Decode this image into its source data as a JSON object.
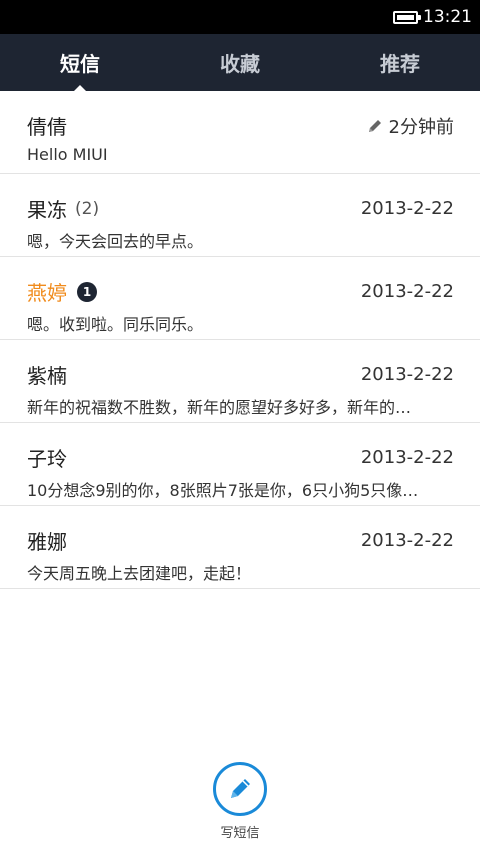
{
  "status_bar": {
    "time": "13:21",
    "battery_icon": "battery-icon"
  },
  "tabs": [
    {
      "label": "短信",
      "active": true
    },
    {
      "label": "收藏",
      "active": false
    },
    {
      "label": "推荐",
      "active": false
    }
  ],
  "threads": [
    {
      "name": "倩倩",
      "count": "",
      "unread": "",
      "date": "2分钟前",
      "draft": true,
      "snippet": "Hello MIUI",
      "highlight": false
    },
    {
      "name": "果冻",
      "count": "(2)",
      "unread": "",
      "date": "2013-2-22",
      "draft": false,
      "snippet": "嗯，今天会回去的早点。",
      "highlight": false
    },
    {
      "name": "燕婷",
      "count": "",
      "unread": "1",
      "date": "2013-2-22",
      "draft": false,
      "snippet": "嗯。收到啦。同乐同乐。",
      "highlight": true
    },
    {
      "name": "紫楠",
      "count": "",
      "unread": "",
      "date": "2013-2-22",
      "draft": false,
      "snippet": "新年的祝福数不胜数，新年的愿望好多好多，新年的…",
      "highlight": false
    },
    {
      "name": "子玲",
      "count": "",
      "unread": "",
      "date": "2013-2-22",
      "draft": false,
      "snippet": "10分想念9别的你，8张照片7张是你，6只小狗5只像…",
      "highlight": false
    },
    {
      "name": "雅娜",
      "count": "",
      "unread": "",
      "date": "2013-2-22",
      "draft": false,
      "snippet": "今天周五晚上去团建吧，走起！",
      "highlight": false
    }
  ],
  "compose": {
    "label": "写短信",
    "icon": "pencil-icon"
  },
  "colors": {
    "tab_bar": "#1e2532",
    "accent_blue": "#1a8ad8",
    "highlight_orange": "#f08b1c"
  }
}
